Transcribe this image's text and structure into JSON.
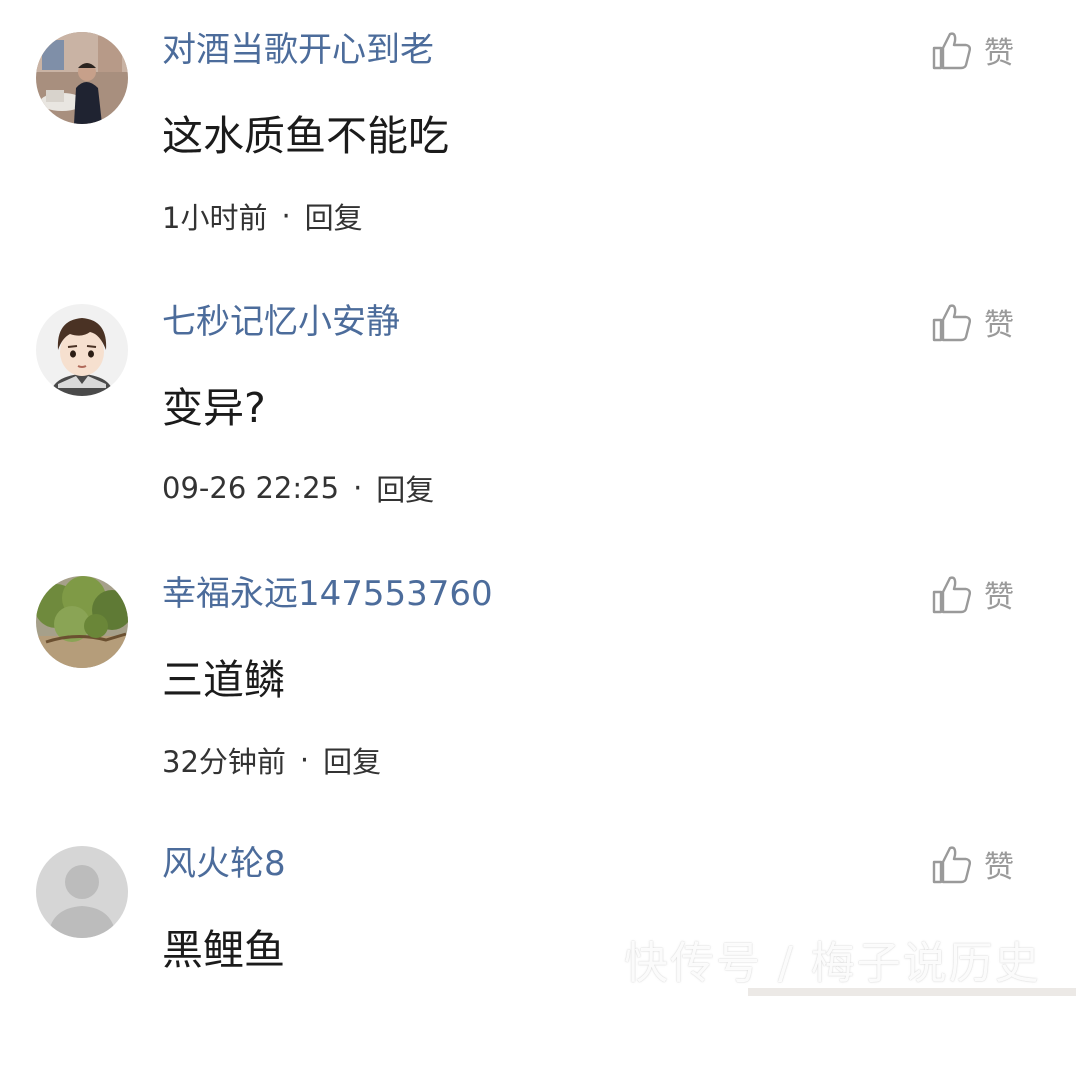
{
  "comments": [
    {
      "username": "对酒当歌开心到老",
      "text": "这水质鱼不能吃",
      "time": "1小时前",
      "reply_label": "回复",
      "like_label": "赞",
      "avatar_icon": "photo-avatar-man-seated"
    },
    {
      "username": "七秒记忆小安静",
      "text": "变异?",
      "time": "09-26 22:25",
      "reply_label": "回复",
      "like_label": "赞",
      "avatar_icon": "cartoon-boy-avatar"
    },
    {
      "username": "幸福永远147553760",
      "text": "三道鳞",
      "time": "32分钟前",
      "reply_label": "回复",
      "like_label": "赞",
      "avatar_icon": "photo-avatar-trees"
    },
    {
      "username": "风火轮8",
      "text": "黑鲤鱼",
      "time": "",
      "reply_label": "",
      "like_label": "赞",
      "avatar_icon": "default-user-avatar"
    }
  ],
  "separator": "·",
  "watermark": "快传号 / 梅子说历史",
  "colors": {
    "username": "#4c6c9b",
    "body_text": "#1b1b1b",
    "meta_text": "#333333",
    "like": "#9a9a9a",
    "background": "#ffffff"
  }
}
